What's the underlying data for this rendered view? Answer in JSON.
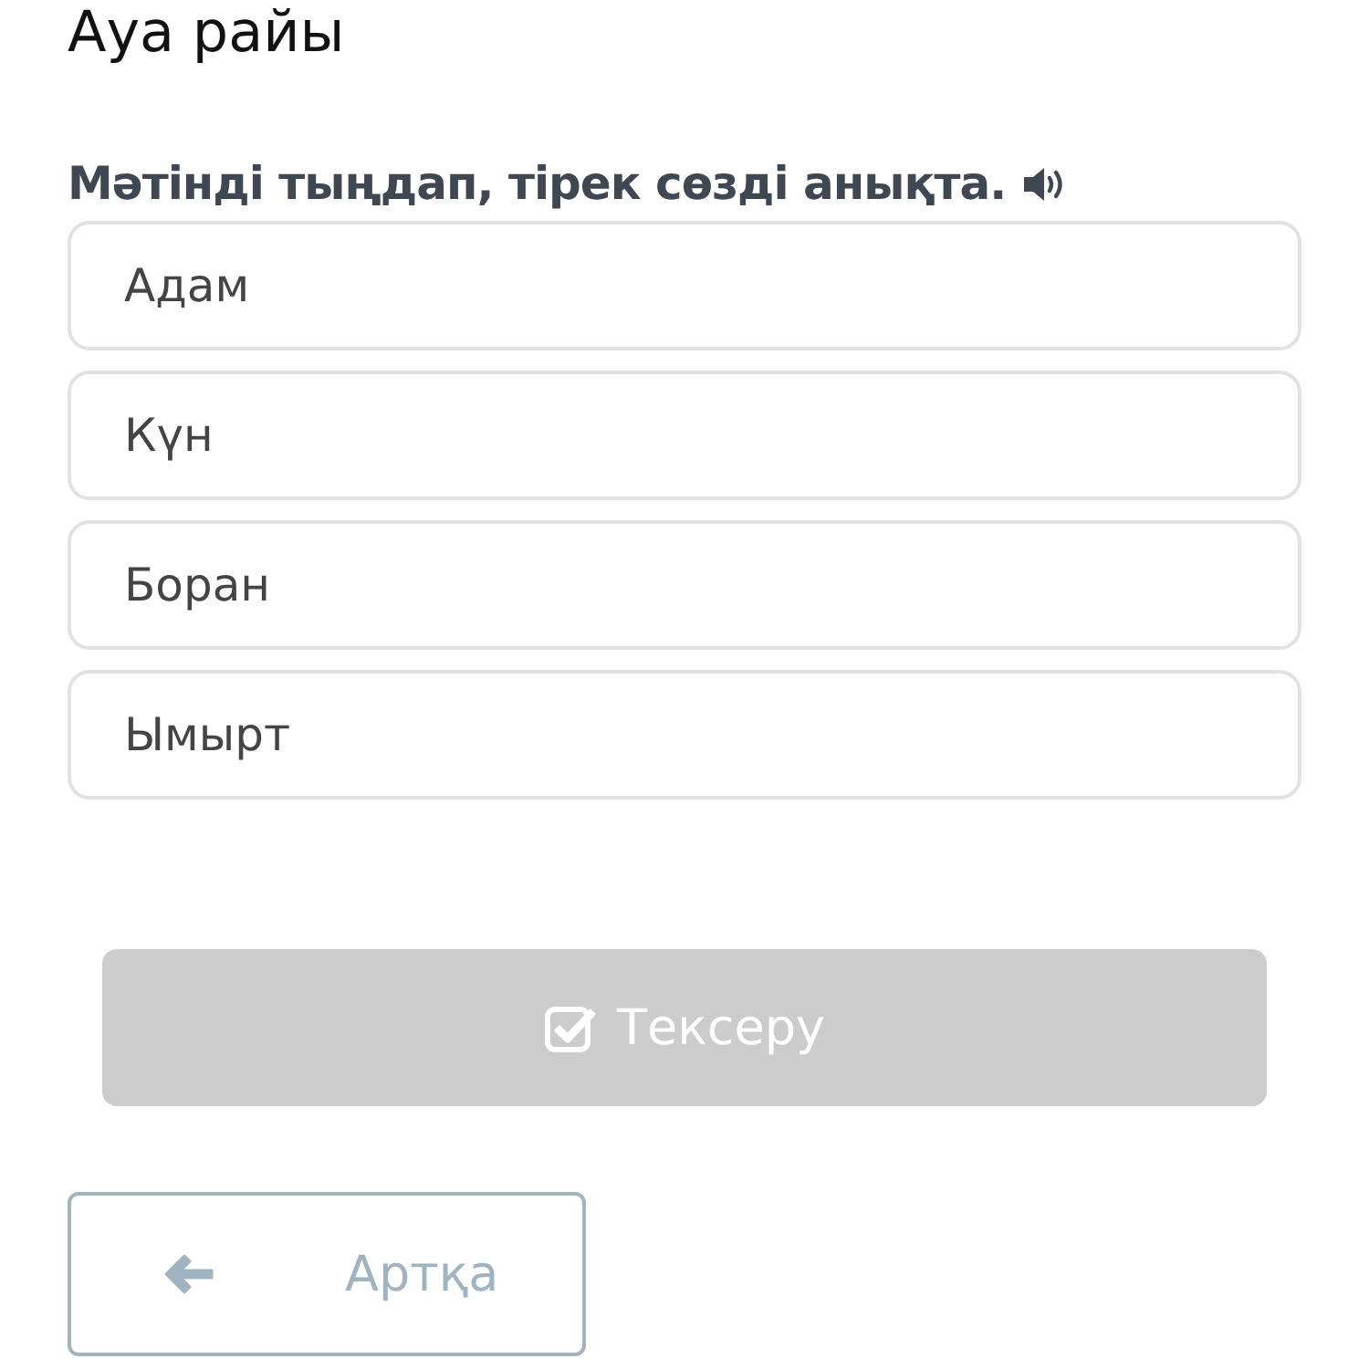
{
  "title": "Ауа райы",
  "question": {
    "text": "Мәтінді тыңдап, тірек сөзді анықта."
  },
  "options": [
    {
      "label": "Адам",
      "selected": false
    },
    {
      "label": "Күн",
      "selected": false
    },
    {
      "label": "Боран",
      "selected": false
    },
    {
      "label": "Ымырт",
      "selected": false
    }
  ],
  "check_button": {
    "label": "Тексеру",
    "disabled": true
  },
  "back_button": {
    "label": "Артқа"
  }
}
